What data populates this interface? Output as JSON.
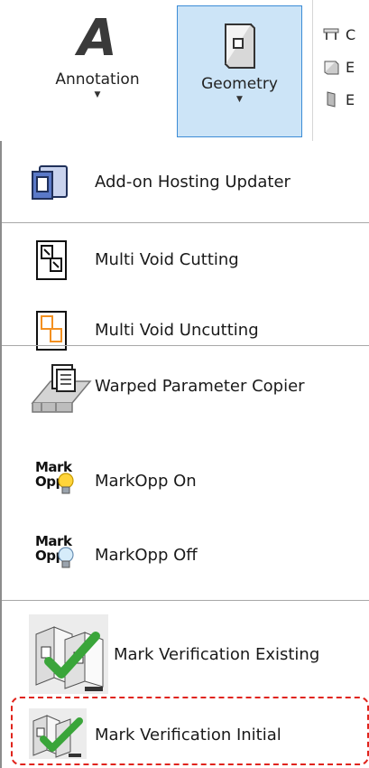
{
  "ribbon": {
    "annotation_label": "Annotation",
    "geometry_label": "Geometry",
    "annotation_glyph": "A",
    "small_items": [
      "C",
      "E",
      "E"
    ]
  },
  "menu": {
    "items": [
      {
        "label": "Add-on Hosting Updater",
        "icon": "hosting-updater-icon"
      },
      {
        "label": "Multi Void Cutting",
        "icon": "void-cutting-icon"
      },
      {
        "label": "Multi Void Uncutting",
        "icon": "void-uncutting-icon"
      },
      {
        "label": "Warped Parameter Copier",
        "icon": "parameter-copier-icon"
      },
      {
        "label": "MarkOpp On",
        "icon": "markopp-on-icon"
      },
      {
        "label": "MarkOpp Off",
        "icon": "markopp-off-icon"
      },
      {
        "label": "Mark Verification Existing",
        "icon": "mark-verification-existing-icon"
      },
      {
        "label": "Mark Verification Initial",
        "icon": "mark-verification-initial-icon"
      }
    ],
    "markopp_top": "Mark",
    "markopp_bottom": "Opp"
  },
  "colors": {
    "selected_bg": "#cce4f7",
    "selected_border": "#3c8cd6",
    "highlight": "#e0241c",
    "check_green": "#3aa53a"
  }
}
